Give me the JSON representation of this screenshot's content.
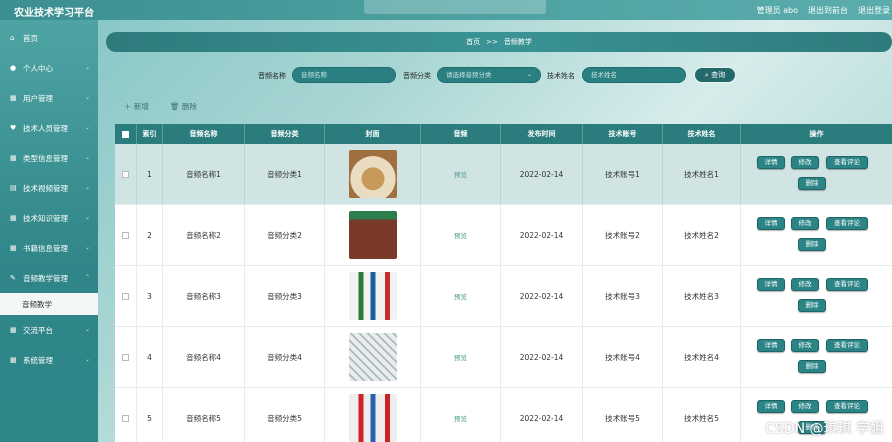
{
  "app": {
    "title": "农业技术学习平台"
  },
  "topbar": {
    "user": "管理员 abo",
    "goto_frontend": "退出到前台",
    "logout": "退出登录"
  },
  "sidebar": {
    "items": [
      {
        "label": "首页",
        "icon": "home-icon"
      },
      {
        "label": "个人中心",
        "icon": "user-icon"
      },
      {
        "label": "用户管理",
        "icon": "grid-icon"
      },
      {
        "label": "技术人员管理",
        "icon": "heart-icon"
      },
      {
        "label": "类型信息管理",
        "icon": "grid-icon"
      },
      {
        "label": "技术视频管理",
        "icon": "list-icon"
      },
      {
        "label": "技术知识管理",
        "icon": "grid-icon"
      },
      {
        "label": "书籍信息管理",
        "icon": "grid-icon"
      },
      {
        "label": "音频教学管理",
        "icon": "pen-icon"
      },
      {
        "label": "音频教学",
        "icon": ""
      },
      {
        "label": "交流平台",
        "icon": "grid-icon"
      },
      {
        "label": "系统管理",
        "icon": "grid-icon"
      }
    ]
  },
  "breadcrumb": {
    "home": "首页",
    "separator": ">>",
    "current": "音频教学"
  },
  "search": {
    "name_label": "音频名称",
    "name_placeholder": "音频名称",
    "category_label": "音频分类",
    "category_placeholder": "请选择音频分类",
    "tech_label": "技术姓名",
    "tech_placeholder": "技术姓名",
    "button": "查询"
  },
  "actions": {
    "add": "新增",
    "delete": "删除"
  },
  "table": {
    "headers": [
      "索引",
      "音频名称",
      "音频分类",
      "封面",
      "音频",
      "发布时间",
      "技术账号",
      "技术姓名",
      "操作"
    ],
    "rows": [
      {
        "index": "1",
        "name": "音频名称1",
        "category": "音频分类1",
        "audio": "预览",
        "date": "2022-02-14",
        "account": "技术账号1",
        "tech": "技术姓名1"
      },
      {
        "index": "2",
        "name": "音频名称2",
        "category": "音频分类2",
        "audio": "预览",
        "date": "2022-02-14",
        "account": "技术账号2",
        "tech": "技术姓名2"
      },
      {
        "index": "3",
        "name": "音频名称3",
        "category": "音频分类3",
        "audio": "预览",
        "date": "2022-02-14",
        "account": "技术账号3",
        "tech": "技术姓名3"
      },
      {
        "index": "4",
        "name": "音频名称4",
        "category": "音频分类4",
        "audio": "预览",
        "date": "2022-02-14",
        "account": "技术账号4",
        "tech": "技术姓名4"
      },
      {
        "index": "5",
        "name": "音频名称5",
        "category": "音频分类5",
        "audio": "预览",
        "date": "2022-02-14",
        "account": "技术账号5",
        "tech": "技术姓名5"
      }
    ],
    "ops": {
      "detail": "详情",
      "edit": "修改",
      "comments": "查看评论",
      "delete": "删除"
    }
  },
  "watermark": "CSDN @琪琪 学姐",
  "colors": {
    "accent": "#2a7c7d",
    "sidebar": "#3a9394",
    "preview": "#4e9d8c"
  }
}
